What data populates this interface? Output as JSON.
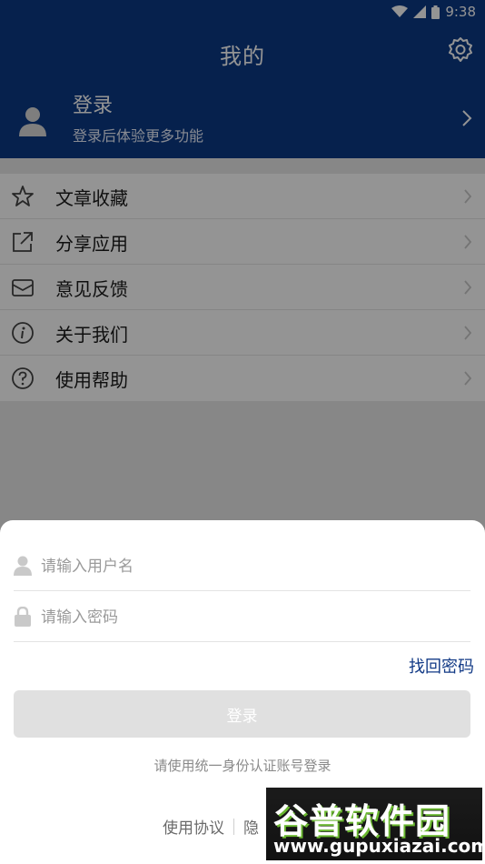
{
  "status_bar": {
    "time": "9:38",
    "icons": [
      "wifi-icon",
      "signal-icon",
      "battery-icon"
    ]
  },
  "app_bar": {
    "title": "我的",
    "settings_icon": "gear-icon"
  },
  "profile": {
    "name": "登录",
    "subtitle": "登录后体验更多功能",
    "avatar_icon": "user-avatar-icon"
  },
  "menu": {
    "items": [
      {
        "label": "文章收藏",
        "icon": "star-icon"
      },
      {
        "label": "分享应用",
        "icon": "share-icon"
      },
      {
        "label": "意见反馈",
        "icon": "mail-icon"
      },
      {
        "label": "关于我们",
        "icon": "info-icon"
      },
      {
        "label": "使用帮助",
        "icon": "help-icon"
      }
    ]
  },
  "login_sheet": {
    "username_placeholder": "请输入用户名",
    "password_placeholder": "请输入密码",
    "forgot_label": "找回密码",
    "login_label": "登录",
    "hint": "请使用统一身份认证账号登录",
    "agreement_label": "使用协议",
    "privacy_label": "隐"
  },
  "watermark": {
    "brand": "谷普软件园",
    "url": "www.gupuxiazai.com"
  },
  "colors": {
    "brand": "#0c3a86",
    "link": "#123a86",
    "disabled_button": "#e0e0e0"
  }
}
